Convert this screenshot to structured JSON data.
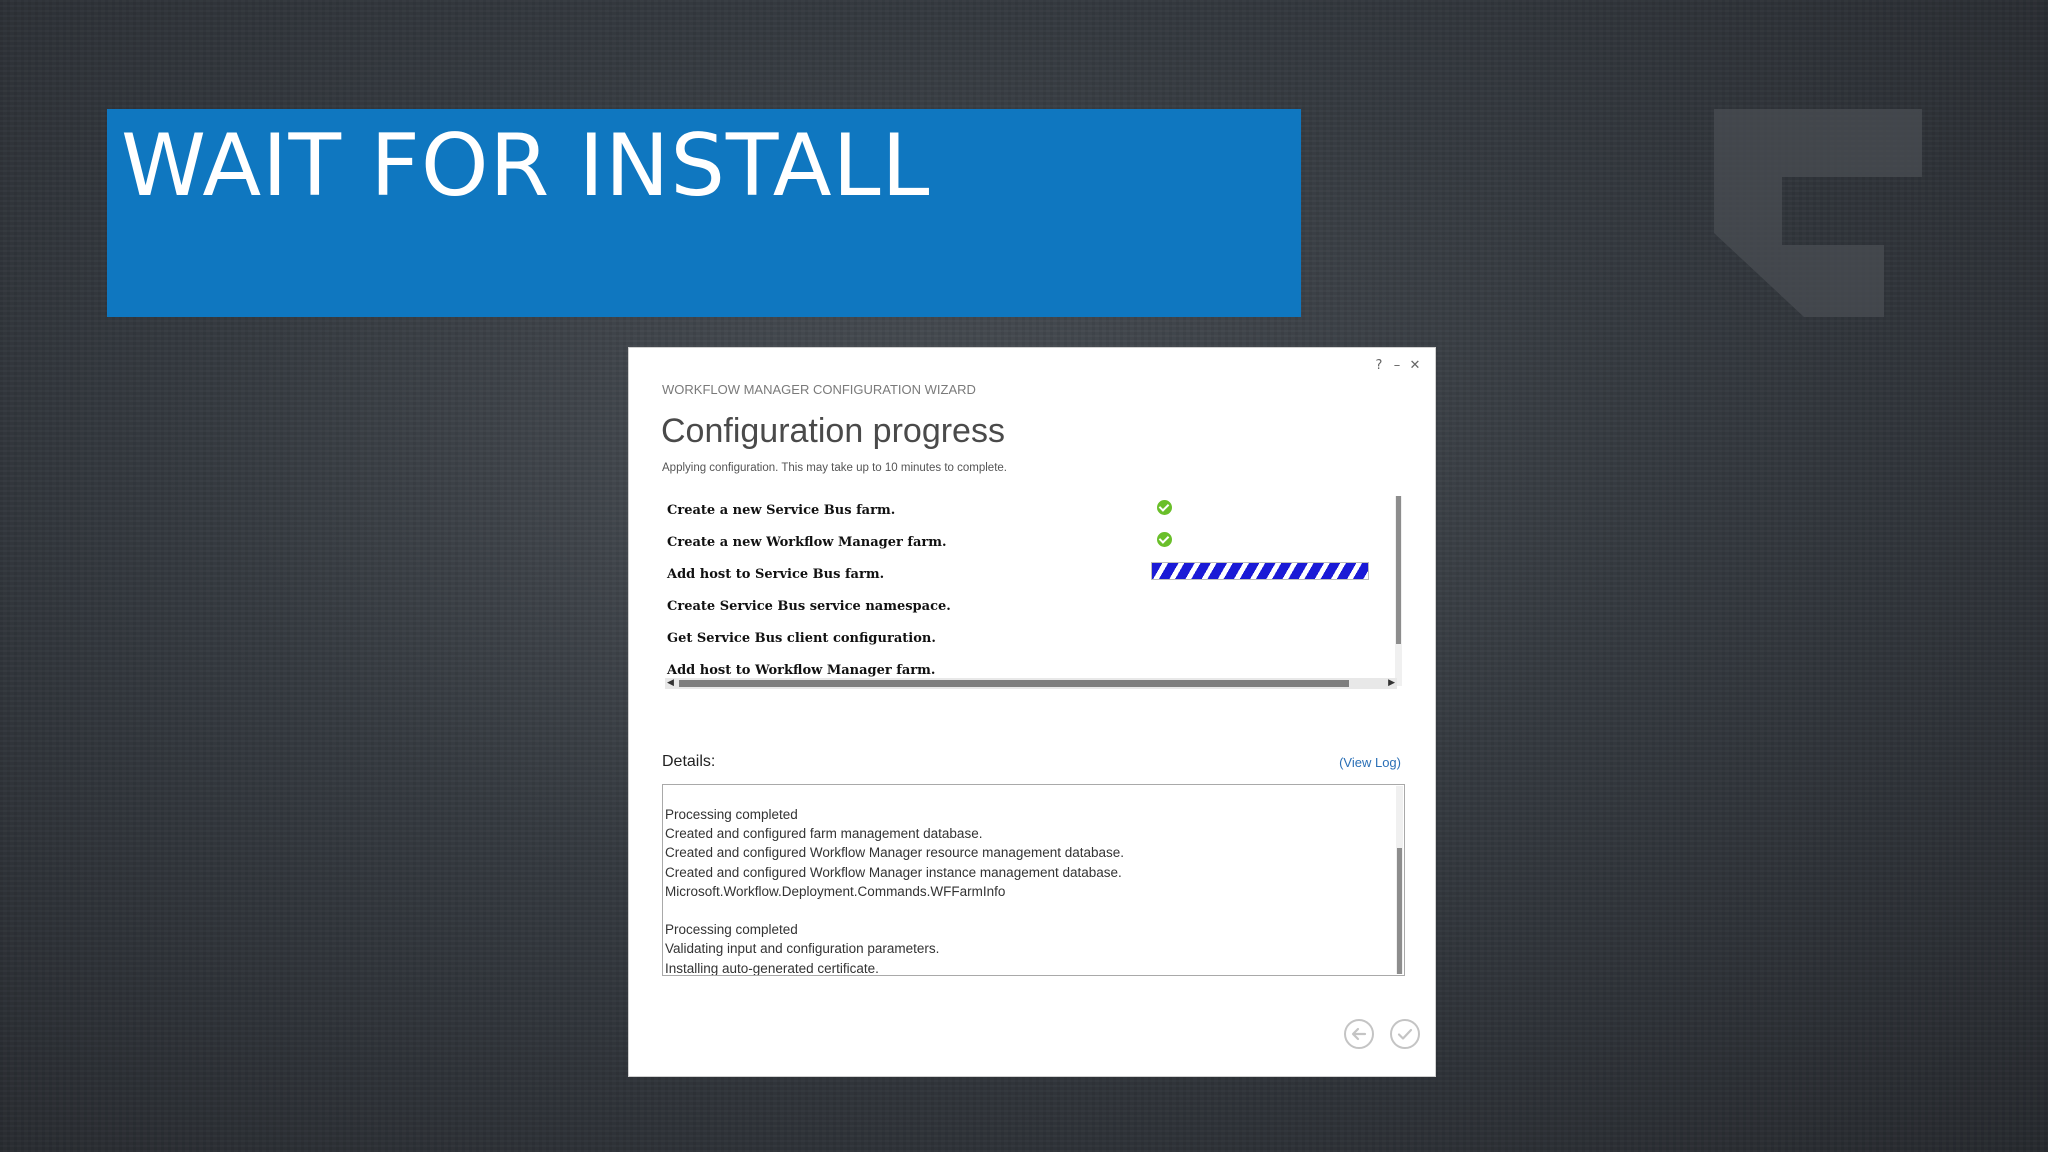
{
  "banner": {
    "title": "WAIT FOR INSTALL"
  },
  "colors": {
    "banner": "#0f77c0",
    "check": "#6abf2a",
    "progress": "#1a1ad6",
    "link": "#2a6fb6"
  },
  "dialog": {
    "window_controls": {
      "help": "?",
      "minimize": "–",
      "close": "✕"
    },
    "wizard_label": "WORKFLOW MANAGER CONFIGURATION WIZARD",
    "title": "Configuration progress",
    "subtitle": "Applying configuration. This may take up to 10 minutes to complete.",
    "steps": [
      {
        "label": "Create a new Service Bus farm.",
        "status": "done"
      },
      {
        "label": "Create a new Workflow Manager farm.",
        "status": "done"
      },
      {
        "label": "Add host to Service Bus farm.",
        "status": "in-progress"
      },
      {
        "label": "Create Service Bus service namespace.",
        "status": "pending"
      },
      {
        "label": "Get Service Bus client configuration.",
        "status": "pending"
      },
      {
        "label": "Add host to Workflow Manager farm.",
        "status": "pending"
      }
    ],
    "details_label": "Details:",
    "view_log": "(View Log)",
    "details_lines": [
      "Processing completed",
      "Created and configured farm management database.",
      "Created and configured Workflow Manager resource management database.",
      "Created and configured Workflow Manager instance management database.",
      "Microsoft.Workflow.Deployment.Commands.WFFarmInfo",
      "",
      "Processing completed",
      "Validating input and configuration parameters.",
      "Installing auto-generated certificate."
    ],
    "buttons": {
      "back_icon": "back-arrow-icon",
      "finish_icon": "checkmark-icon"
    }
  }
}
